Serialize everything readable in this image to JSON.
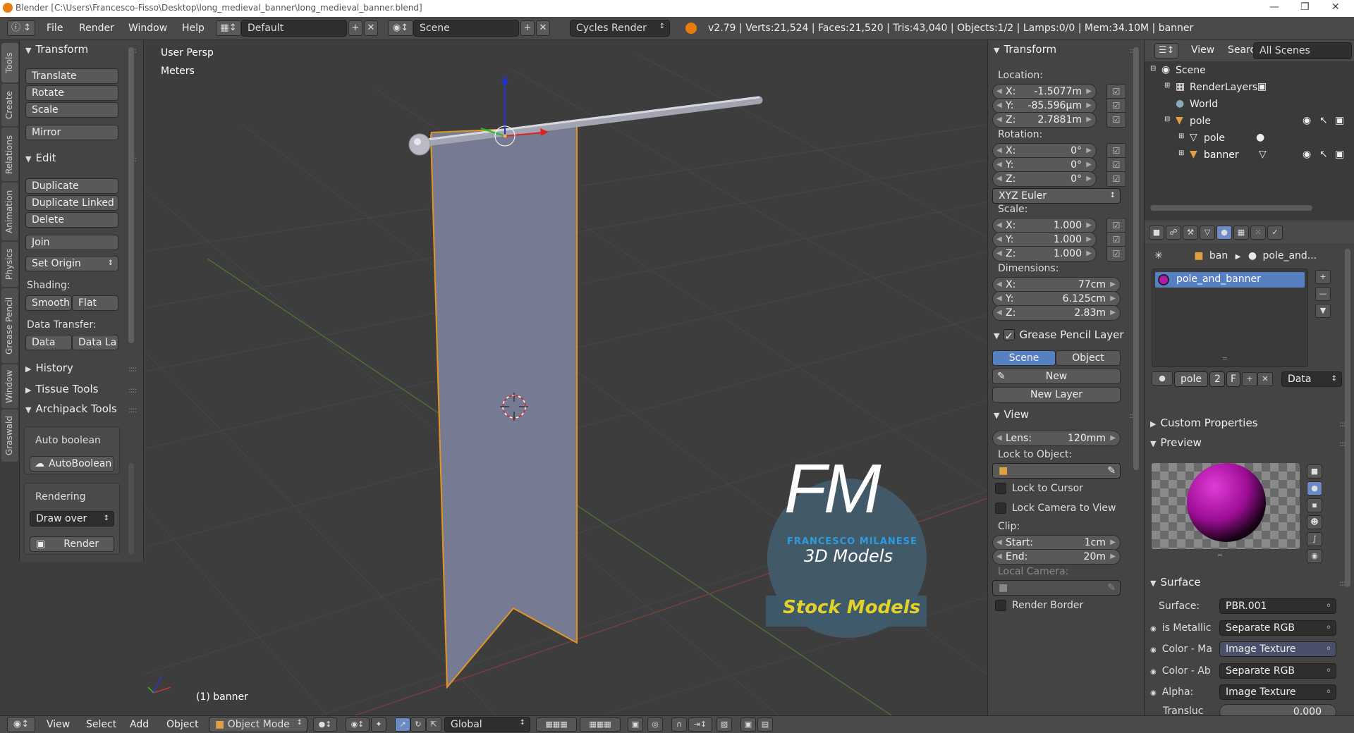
{
  "title_bar": {
    "text": "Blender [C:\\Users\\Francesco-Fisso\\Desktop\\long_medieval_banner\\long_medieval_banner.blend]"
  },
  "top_menu": [
    "File",
    "Render",
    "Window",
    "Help"
  ],
  "screen_layout": "Default",
  "scene": "Scene",
  "render_engine": "Cycles Render",
  "stats": "v2.79 | Verts:21,524 | Faces:21,520 | Tris:43,040 | Objects:1/2 | Lamps:0/0 | Mem:34.10M | banner",
  "left_tabs": [
    "Tools",
    "Create",
    "Relations",
    "Animation",
    "Physics",
    "Grease Pencil",
    "Window",
    "Graswald"
  ],
  "tool_shelf": {
    "transform_header": "Transform",
    "translate": "Translate",
    "rotate": "Rotate",
    "scale": "Scale",
    "mirror": "Mirror",
    "edit_header": "Edit",
    "duplicate": "Duplicate",
    "duplicate_linked": "Duplicate Linked",
    "delete": "Delete",
    "join": "Join",
    "set_origin": "Set Origin",
    "shading_label": "Shading:",
    "smooth": "Smooth",
    "flat": "Flat",
    "data_transfer_label": "Data Transfer:",
    "data": "Data",
    "data_la": "Data La",
    "history": "History",
    "tissue": "Tissue Tools",
    "archipack": "Archipack Tools",
    "auto_boolean_label": "Auto boolean",
    "auto_boolean_btn": "AutoBoolean",
    "rendering_label": "Rendering",
    "draw_over": "Draw over",
    "render_btn": "Render"
  },
  "viewport": {
    "view_name": "User Persp",
    "units": "Meters",
    "object_label": "(1) banner",
    "watermark_fm": "FM",
    "watermark_name": "FRANCESCO MILANESE",
    "watermark_3d": "3D Models",
    "watermark_stock": "Stock Models"
  },
  "properties": {
    "transform_header": "Transform",
    "location_label": "Location:",
    "loc": [
      {
        "k": "X:",
        "v": "-1.5077m"
      },
      {
        "k": "Y:",
        "v": "-85.596µm"
      },
      {
        "k": "Z:",
        "v": "2.7881m"
      }
    ],
    "rotation_label": "Rotation:",
    "rot": [
      {
        "k": "X:",
        "v": "0°"
      },
      {
        "k": "Y:",
        "v": "0°"
      },
      {
        "k": "Z:",
        "v": "0°"
      }
    ],
    "rotation_mode": "XYZ Euler",
    "scale_label": "Scale:",
    "scl": [
      {
        "k": "X:",
        "v": "1.000"
      },
      {
        "k": "Y:",
        "v": "1.000"
      },
      {
        "k": "Z:",
        "v": "1.000"
      }
    ],
    "dimensions_label": "Dimensions:",
    "dim": [
      {
        "k": "X:",
        "v": "77cm"
      },
      {
        "k": "Y:",
        "v": "6.125cm"
      },
      {
        "k": "Z:",
        "v": "2.83m"
      }
    ],
    "gp_header": "Grease Pencil Layer",
    "gp_scene": "Scene",
    "gp_object": "Object",
    "gp_new": "New",
    "gp_new_layer": "New Layer",
    "view_header": "View",
    "lens_label": "Lens:",
    "lens_value": "120mm",
    "lock_object_label": "Lock to Object:",
    "lock_cursor": "Lock to Cursor",
    "lock_camera": "Lock Camera to View",
    "clip_label": "Clip:",
    "clip_start_label": "Start:",
    "clip_start": "1cm",
    "clip_end_label": "End:",
    "clip_end": "20m",
    "local_camera": "Local Camera:",
    "render_border": "Render Border"
  },
  "outliner": {
    "view": "View",
    "search": "Search",
    "filter": "All Scenes",
    "items": [
      "Scene",
      "RenderLayers",
      "World",
      "pole",
      "pole",
      "banner"
    ]
  },
  "material": {
    "crumb_obj": "ban",
    "crumb_mat": "pole_and...",
    "slot": "pole_and_banner",
    "mat_name": "pole",
    "users": "2",
    "f": "F",
    "link": "Data",
    "custom_props": "Custom Properties",
    "preview": "Preview",
    "surface_header": "Surface",
    "surface_label": "Surface:",
    "surface_value": "PBR.001",
    "inputs": [
      {
        "k": "is Metallic",
        "v": "Separate RGB"
      },
      {
        "k": "Color - Ma",
        "v": "Image Texture"
      },
      {
        "k": "Color - Ab",
        "v": "Separate RGB"
      },
      {
        "k": "Alpha:",
        "v": "Image Texture"
      }
    ],
    "transl_label": "Transluc",
    "transl_value": "0.000"
  },
  "bottom": {
    "view": "View",
    "select": "Select",
    "add": "Add",
    "object": "Object",
    "mode": "Object Mode",
    "orientation": "Global"
  }
}
